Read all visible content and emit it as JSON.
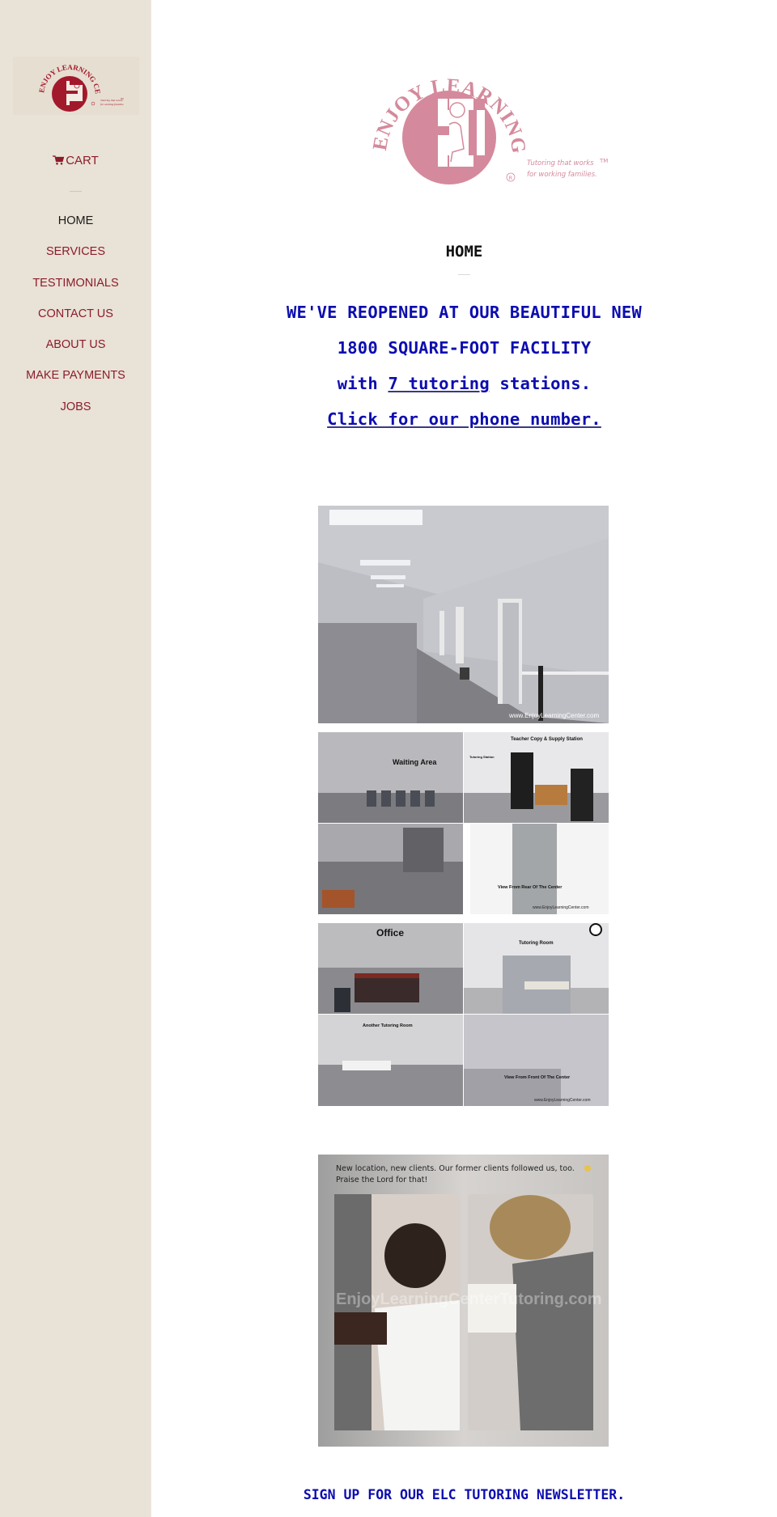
{
  "brand": {
    "name": "ENJOY LEARNING CENTER",
    "tagline_line1": "Tutoring that works",
    "tagline_line2": "for working families.",
    "registered_mark": "R",
    "trademark": "TM",
    "colors": {
      "sidebar_bg": "#e9e2d6",
      "nav_link": "#8c1c2c",
      "nav_active": "#1a1a1a",
      "logo_sidebar": "#a3192c",
      "logo_main": "#d48a9c",
      "headline_blue": "#0d0db0",
      "phone_link": "#7a1020"
    }
  },
  "sidebar": {
    "cart_label": "CART",
    "nav_items": [
      {
        "label": "HOME",
        "active": true
      },
      {
        "label": "SERVICES",
        "active": false
      },
      {
        "label": "TESTIMONIALS",
        "active": false
      },
      {
        "label": "CONTACT US",
        "active": false
      },
      {
        "label": "ABOUT US",
        "active": false
      },
      {
        "label": "MAKE PAYMENTS",
        "active": false
      },
      {
        "label": "JOBS",
        "active": false
      }
    ]
  },
  "main": {
    "page_title": "HOME",
    "headline_line1": "WE'VE REOPENED AT OUR BEAUTIFUL NEW",
    "headline_line2": "1800 SQUARE-FOOT FACILITY",
    "headline_line3_prefix": "with ",
    "headline_line3_link": "7 tutoring",
    "headline_line3_suffix": " stations.",
    "phone_link": "Click for our phone number.",
    "photos": [
      {
        "alt": "Facility hallway with cubicles",
        "watermark": "www.EnjoyLearningCenter.com"
      },
      {
        "alt": "Facility collage 1",
        "captions": [
          "Waiting Area",
          "Teacher Copy & Supply Station",
          "Tutoring Station",
          "View From Rear Of The Center"
        ],
        "watermark": "www.EnjoyLearningCenter.com"
      },
      {
        "alt": "Facility collage 2",
        "captions": [
          "Office",
          "Tutoring Room",
          "Another Tutoring Room",
          "View From Front Of The Center"
        ],
        "watermark": "www.EnjoyLearningCenter.com"
      },
      {
        "alt": "Students tutoring",
        "text_line1": "New location, new clients.  Our  former clients followed us, too.",
        "text_line2": "Praise the Lord for that!",
        "watermark": "EnjoyLearningCenterTutoring.com"
      }
    ],
    "newsletter_link": "SIGN UP FOR OUR ELC TUTORING NEWSLETTER."
  }
}
